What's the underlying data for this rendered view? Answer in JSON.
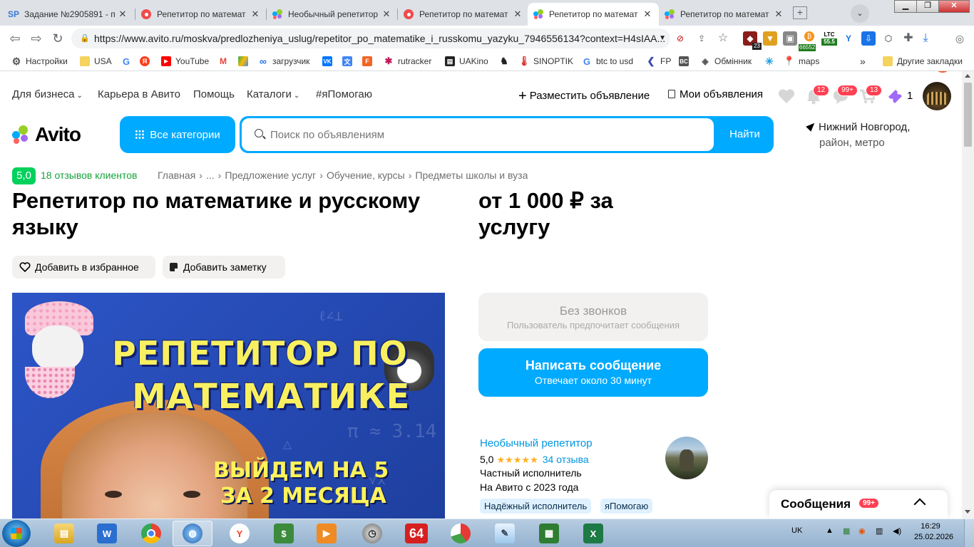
{
  "browser": {
    "tabs": [
      {
        "title": "Задание №2905891 - п",
        "favicon": "SP"
      },
      {
        "title": "Репетитор по математ",
        "favicon": "red-dot"
      },
      {
        "title": "Необычный репетитор",
        "favicon": "avito"
      },
      {
        "title": "Репетитор по математ",
        "favicon": "red-dot"
      },
      {
        "title": "Репетитор по математ",
        "favicon": "avito",
        "active": true
      },
      {
        "title": "Репетитор по математ",
        "favicon": "avito"
      }
    ],
    "url": "https://www.avito.ru/moskva/predlozheniya_uslug/repetitor_po_matematike_i_russkomu_yazyku_7946556134?context=H4sIAA...",
    "extensions": {
      "badge_23": "23",
      "btc_price": "66552",
      "ltc_label": "LTC",
      "ltc_price": "55.5",
      "profile_initial": "I"
    },
    "bookmarks": [
      {
        "label": "Настройки"
      },
      {
        "label": "USA"
      },
      {
        "label": ""
      },
      {
        "label": ""
      },
      {
        "label": "YouTube"
      },
      {
        "label": ""
      },
      {
        "label": ""
      },
      {
        "label": "загрузчик"
      },
      {
        "label": ""
      },
      {
        "label": ""
      },
      {
        "label": ""
      },
      {
        "label": "rutracker"
      },
      {
        "label": "UAKino"
      },
      {
        "label": ""
      },
      {
        "label": "SINOPTIK"
      },
      {
        "label": "btc to usd"
      },
      {
        "label": "FP"
      },
      {
        "label": ""
      },
      {
        "label": "Обмінник"
      },
      {
        "label": ""
      },
      {
        "label": "maps"
      }
    ],
    "more_bookmarks": "»",
    "other_bookmarks": "Другие закладки"
  },
  "header": {
    "nav": [
      "Для бизнеса",
      "Карьера в Авито",
      "Помощь",
      "Каталоги",
      "#яПомогаю"
    ],
    "post_ad": "Разместить объявление",
    "my_ads": "Мои объявления",
    "notif_count": "12",
    "messages_count": "99+",
    "cart_count": "13",
    "bonus_count": "1",
    "logo": "Avito",
    "categories_button": "Все категории",
    "search_placeholder": "Поиск по объявлениям",
    "search_button": "Найти",
    "location": "Нижний Новгород,",
    "location_sub": "район, метро"
  },
  "listing": {
    "rating": "5,0",
    "reviews_link": "18 отзывов клиентов",
    "breadcrumbs": [
      "Главная",
      "...",
      "Предложение услуг",
      "Обучение, курсы",
      "Предметы школы и вуза"
    ],
    "title": "Репетитор по математике и русскому языку",
    "price": "от 1 000 ₽ за услугу",
    "add_favorite": "Добавить в избранное",
    "add_note": "Добавить заметку",
    "image_text": {
      "line1": "РЕПЕТИТОР ПО",
      "line2": "МАТЕМАТИКЕ",
      "line3": "ВЫЙДЕМ НА 5",
      "line4": "ЗА 2 МЕСЯЦА"
    }
  },
  "contact": {
    "no_calls_title": "Без звонков",
    "no_calls_sub": "Пользователь предпочитает сообщения",
    "message_title": "Написать сообщение",
    "message_sub": "Отвечает около 30 минут"
  },
  "seller": {
    "name": "Необычный репетитор",
    "rating": "5,0",
    "stars": "★★★★★",
    "reviews": "34 отзыва",
    "type": "Частный исполнитель",
    "since": "На Авито с 2023 года",
    "tags": [
      "Надёжный исполнитель",
      "яПомогаю"
    ]
  },
  "messenger": {
    "title": "Сообщения",
    "count": "99+"
  },
  "taskbar": {
    "lang": "UK",
    "time": "16:29",
    "date": "25.02.2026",
    "app_64_label": "64"
  },
  "colors": {
    "avito_blue": "#00aaff",
    "rating_green": "#02d15c",
    "badge_red": "#ff4053"
  }
}
